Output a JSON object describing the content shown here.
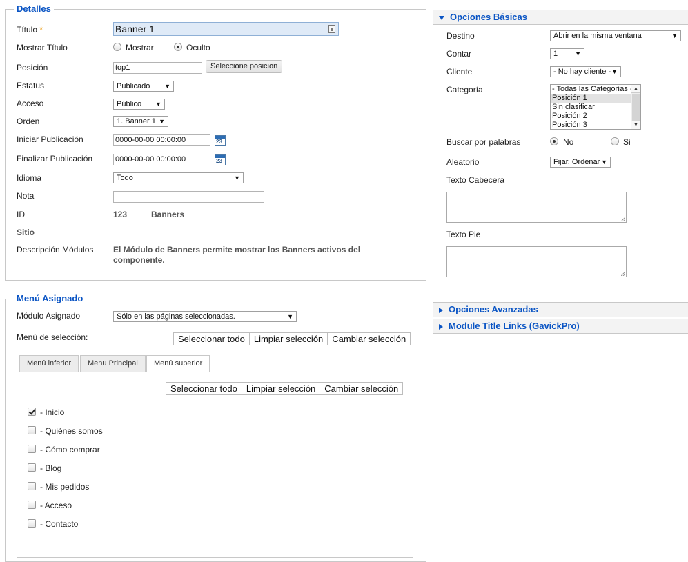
{
  "detalles": {
    "legend": "Detalles",
    "titulo_label": "Título",
    "required_mark": "*",
    "titulo_value": "Banner 1",
    "mostrar_titulo_label": "Mostrar Título",
    "mostrar_option": "Mostrar",
    "oculto_option": "Oculto",
    "posicion_label": "Posición",
    "posicion_value": "top1",
    "seleccione_button": "Seleccione posicion",
    "estatus_label": "Estatus",
    "estatus_value": "Publicado",
    "acceso_label": "Acceso",
    "acceso_value": "Público",
    "orden_label": "Orden",
    "orden_value": "1. Banner 1",
    "iniciar_label": "Iniciar Publicación",
    "iniciar_value": "0000-00-00 00:00:00",
    "finalizar_label": "Finalizar Publicación",
    "finalizar_value": "0000-00-00 00:00:00",
    "calendar_day": "23",
    "idioma_label": "Idioma",
    "idioma_value": "Todo",
    "nota_label": "Nota",
    "nota_value": "",
    "id_label": "ID",
    "id_value": "123",
    "id_type": "Banners",
    "sitio_label": "Sitio",
    "descripcion_label": "Descripción Módulos",
    "descripcion_line1": "El Módulo de Banners permite mostrar los Banners activos del",
    "descripcion_line2": "componente."
  },
  "menu_asignado": {
    "legend": "Menú Asignado",
    "modulo_label": "Módulo Asignado",
    "modulo_value": "Sólo en las páginas seleccionadas.",
    "menu_seleccion_label": "Menú de selección:",
    "select_all": "Seleccionar todo",
    "clear_selection": "Limpiar selección",
    "toggle_selection": "Cambiar selección",
    "tabs": [
      "Menú inferior",
      "Menu Principal",
      "Menú superior"
    ],
    "items": [
      {
        "label": "- Inicio",
        "checked": true
      },
      {
        "label": "- Quiénes somos",
        "checked": false
      },
      {
        "label": "- Cómo comprar",
        "checked": false
      },
      {
        "label": "- Blog",
        "checked": false
      },
      {
        "label": "- Mis pedidos",
        "checked": false
      },
      {
        "label": "- Acceso",
        "checked": false
      },
      {
        "label": "- Contacto",
        "checked": false
      }
    ]
  },
  "opciones_basicas": {
    "header": "Opciones Básicas",
    "destino_label": "Destino",
    "destino_value": "Abrir en la misma ventana",
    "contar_label": "Contar",
    "contar_value": "1",
    "cliente_label": "Cliente",
    "cliente_value": "- No hay cliente -",
    "categoria_label": "Categoría",
    "categoria_options": [
      "- Todas las Categorías -",
      "Posición 1",
      "Sin clasificar",
      "Posición 2",
      "Posición 3"
    ],
    "buscar_label": "Buscar por palabras",
    "no_option": "No",
    "si_option": "Si",
    "aleatorio_label": "Aleatorio",
    "aleatorio_value": "Fijar, Ordenar",
    "texto_cabecera_label": "Texto Cabecera",
    "texto_pie_label": "Texto Pie"
  },
  "accordion": {
    "avanzadas": "Opciones Avanzadas",
    "gavick": "Module Title Links (GavickPro)"
  },
  "colors": {
    "accent": "#0b55c4",
    "required": "#e89400",
    "title_bg": "#dfeaf7"
  }
}
